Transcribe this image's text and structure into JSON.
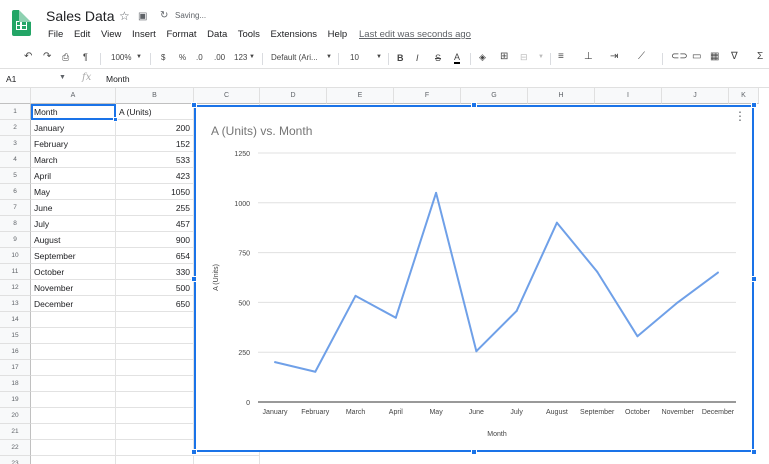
{
  "titlebar": {
    "doc_title": "Sales Data",
    "saving": "Saving...",
    "menu": [
      "File",
      "Edit",
      "View",
      "Insert",
      "Format",
      "Data",
      "Tools",
      "Extensions",
      "Help"
    ],
    "last_edit": "Last edit was seconds ago"
  },
  "toolbar": {
    "zoom": "100%",
    "currency": "$",
    "percent": "%",
    "dec_less": ".0",
    "dec_more": ".00",
    "more_formats": "123",
    "font": "Default (Ari...",
    "font_size": "10",
    "bold": "B",
    "italic": "I",
    "strike": "S",
    "text_color": "A"
  },
  "formulabar": {
    "cell_ref": "A1",
    "fx": "fx",
    "value": "Month"
  },
  "sheet": {
    "columns": [
      "A",
      "B",
      "C",
      "D",
      "E",
      "F",
      "G",
      "H",
      "I",
      "J",
      "K"
    ],
    "rows": [
      "1",
      "2",
      "3",
      "4",
      "5",
      "6",
      "7",
      "8",
      "9",
      "10",
      "11",
      "12",
      "13",
      "14",
      "15",
      "16",
      "17",
      "18",
      "19",
      "20",
      "21",
      "22",
      "23"
    ],
    "header_a": "Month",
    "header_b": "A (Units)",
    "data": [
      {
        "month": "January",
        "units": "200"
      },
      {
        "month": "February",
        "units": "152"
      },
      {
        "month": "March",
        "units": "533"
      },
      {
        "month": "April",
        "units": "423"
      },
      {
        "month": "May",
        "units": "1050"
      },
      {
        "month": "June",
        "units": "255"
      },
      {
        "month": "July",
        "units": "457"
      },
      {
        "month": "August",
        "units": "900"
      },
      {
        "month": "September",
        "units": "654"
      },
      {
        "month": "October",
        "units": "330"
      },
      {
        "month": "November",
        "units": "500"
      },
      {
        "month": "December",
        "units": "650"
      }
    ]
  },
  "chart_data": {
    "type": "line",
    "title": "A (Units) vs. Month",
    "xlabel": "Month",
    "ylabel": "A (Units)",
    "categories": [
      "January",
      "February",
      "March",
      "April",
      "May",
      "June",
      "July",
      "August",
      "September",
      "October",
      "November",
      "December"
    ],
    "series": [
      {
        "values": [
          200,
          152,
          533,
          423,
          1050,
          255,
          457,
          900,
          654,
          330,
          500,
          650
        ],
        "color": "#6fa0e8"
      }
    ],
    "ylim": [
      0,
      1250
    ],
    "yticks": [
      0,
      250,
      500,
      750,
      1000,
      1250
    ],
    "grid": true,
    "legend": "none"
  }
}
